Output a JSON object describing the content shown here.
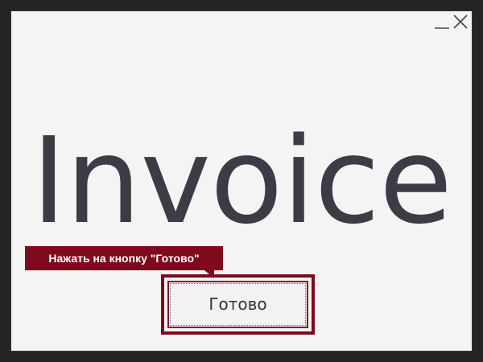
{
  "window": {
    "controls": [
      {
        "name": "minimize",
        "icon": "minimize-icon"
      },
      {
        "name": "close",
        "icon": "close-icon"
      }
    ]
  },
  "logo": {
    "text": "Invoice",
    "color": "#3c3c46"
  },
  "tooltip": {
    "text": "Нажать на кнопку \"Готово\"",
    "color": "#7f0a1d"
  },
  "button": {
    "label": "Готово"
  }
}
